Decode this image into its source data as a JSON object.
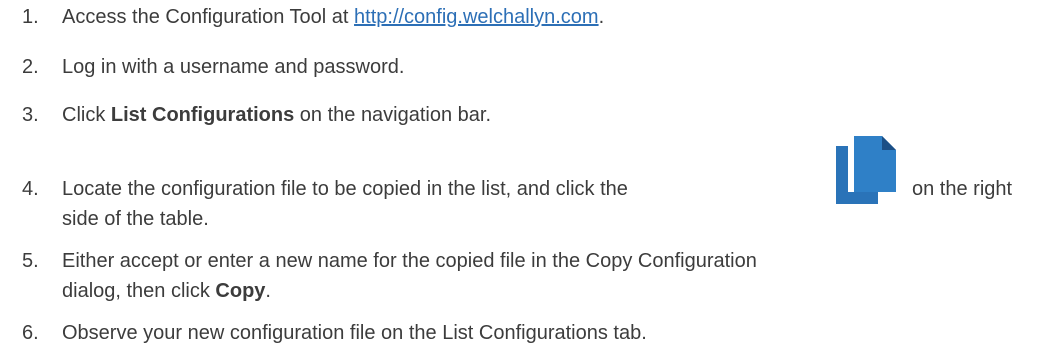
{
  "steps": [
    {
      "number": "1.",
      "text_before": "Access the Configuration Tool at ",
      "link": "http://config.welchallyn.com",
      "text_after": "."
    },
    {
      "number": "2.",
      "text": "Log in with a username and password."
    },
    {
      "number": "3.",
      "text_before": "Click ",
      "bold": "List Configurations",
      "text_after": " on the navigation bar."
    },
    {
      "number": "4.",
      "text_before": "Locate the configuration file to be copied in the list, and click the",
      "icon": "copy-icon",
      "text_after": "on the right",
      "line2": "side of the table."
    },
    {
      "number": "5.",
      "line1": "Either accept or enter a new name for the copied file in the Copy Configuration",
      "line2_before": "dialog, then click ",
      "bold": "Copy",
      "line2_after": "."
    },
    {
      "number": "6.",
      "text": "Observe your new configuration file on the List Configurations tab."
    }
  ],
  "colors": {
    "text": "#3c3c3c",
    "link": "#2c6fb6",
    "icon_front": "#2f80c7",
    "icon_back": "#2a73b8",
    "icon_fold": "#1b4f86"
  }
}
